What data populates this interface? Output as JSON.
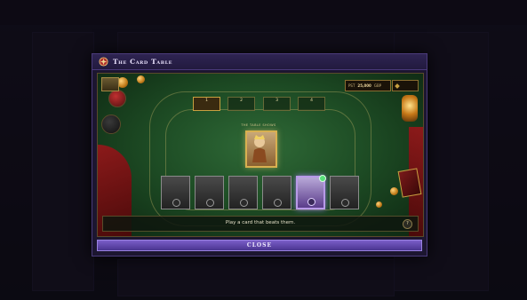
{
  "modal": {
    "title": "The Card Table",
    "close_label": "CLOSE"
  },
  "board": {
    "round_slots": [
      {
        "number": "1",
        "active": true
      },
      {
        "number": "2",
        "active": false
      },
      {
        "number": "3",
        "active": false
      },
      {
        "number": "4",
        "active": false
      }
    ],
    "stats": {
      "first_value": "25,000",
      "first_prefix": "PST",
      "first_suffix": "GBP"
    },
    "boss_label": "THE TABLE SHOWS",
    "hand_cards": [
      {
        "name": "card-1",
        "selected": false
      },
      {
        "name": "card-2",
        "selected": false
      },
      {
        "name": "card-3",
        "selected": false
      },
      {
        "name": "card-4",
        "selected": false
      },
      {
        "name": "card-5",
        "selected": true
      },
      {
        "name": "card-6",
        "selected": false
      }
    ],
    "message": "Play a card that beats them.",
    "help_label": "?"
  },
  "colors": {
    "felt": "#1e4d25",
    "accent_gold": "#c8a040",
    "selection_purple": "#b89ae8",
    "close_button": "#6a50b8"
  },
  "icons": {
    "title": "card-table-icon",
    "help": "help-icon"
  }
}
